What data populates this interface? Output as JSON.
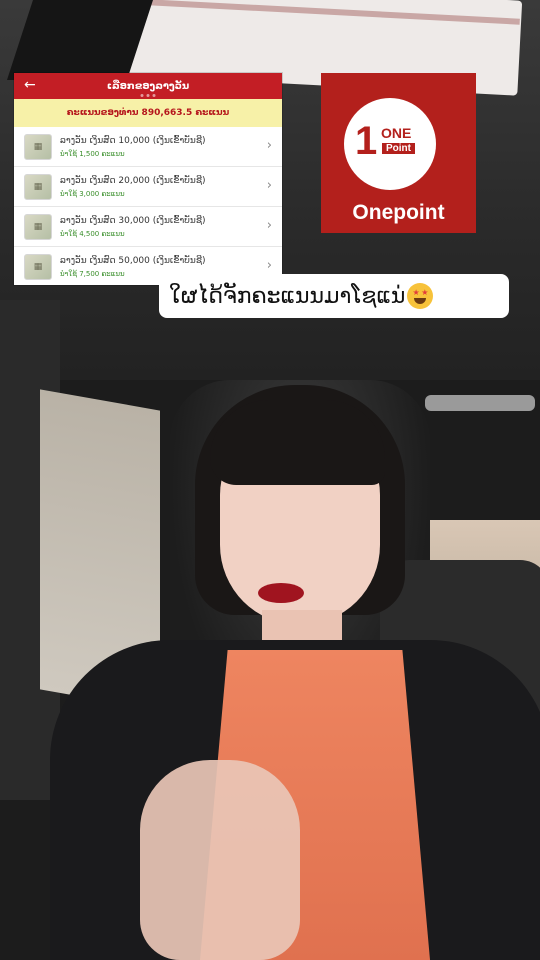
{
  "app_screen": {
    "title": "ເລືອກຂອງລາງວັນ",
    "balance_text": "ຄະແນນຂອງທ່ານ 890,663.5 ຄະແນນ",
    "rewards": [
      {
        "name": "ລາງວັນ ເງິນສົດ 10,000 (ເງິນເຂົ້າບັນຊີ)",
        "cost": "ນຳໃຊ້ 1,500 ຄະແນນ"
      },
      {
        "name": "ລາງວັນ ເງິນສົດ 20,000 (ເງິນເຂົ້າບັນຊີ)",
        "cost": "ນຳໃຊ້ 3,000 ຄະແນນ"
      },
      {
        "name": "ລາງວັນ ເງິນສົດ 30,000 (ເງິນເຂົ້າບັນຊີ)",
        "cost": "ນຳໃຊ້ 4,500 ຄະແນນ"
      },
      {
        "name": "ລາງວັນ ເງິນສົດ 50,000 (ເງິນເຂົ້າບັນຊີ)",
        "cost": "ນຳໃຊ້ 7,500 ຄະແນນ"
      }
    ]
  },
  "logo": {
    "mark_number": "1",
    "mark_word": "ONE",
    "mark_tag": "Point",
    "name": "Onepoint",
    "brand_color": "#b3201c"
  },
  "caption": {
    "text": "ໃຜໄດ້ຈັກຄະແນນມາໂຊແນ່",
    "emoji": "star-struck-emoji"
  },
  "colors": {
    "header_red": "#c31e25",
    "balance_bg": "#f7f1a8",
    "cost_green": "#3a8f2b"
  }
}
